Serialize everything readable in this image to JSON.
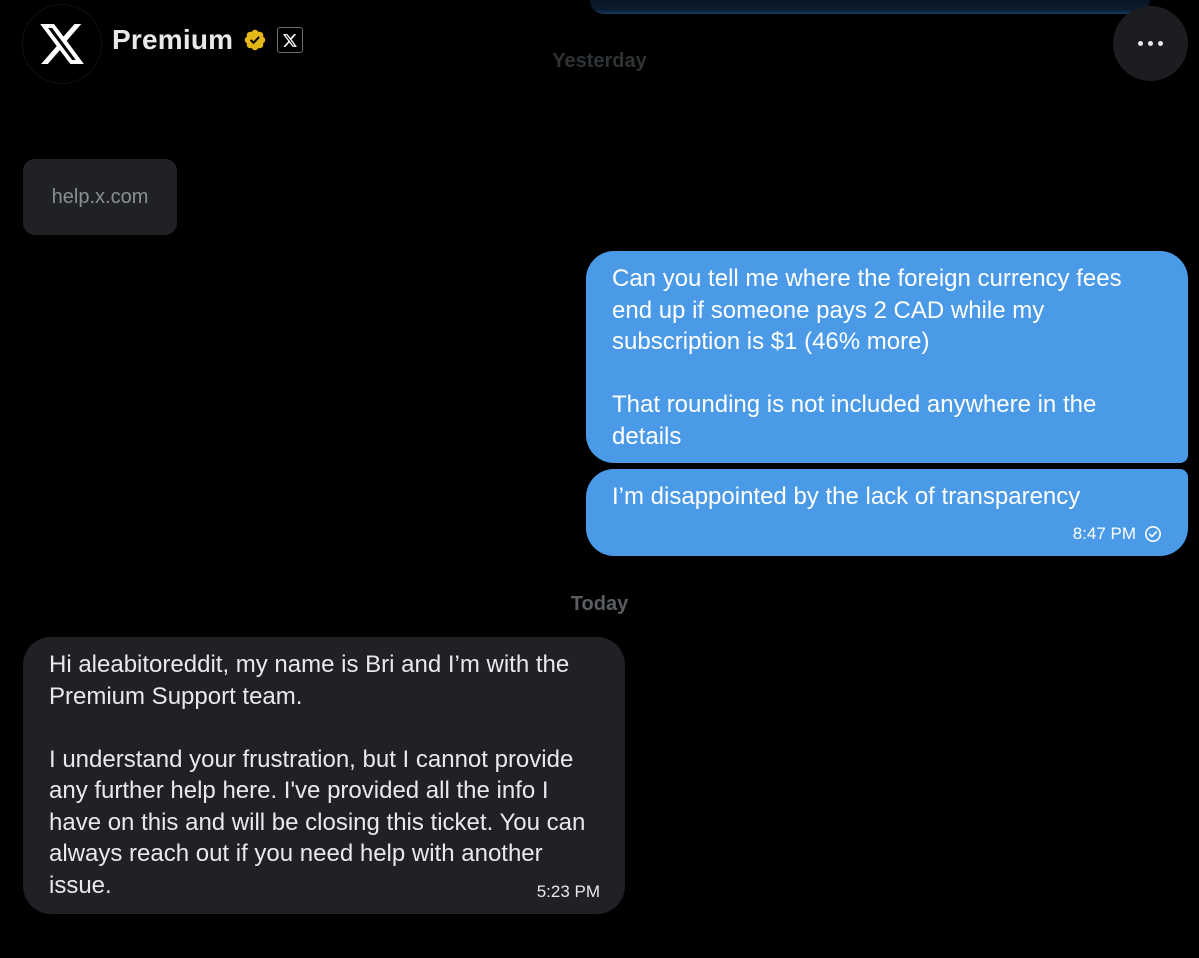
{
  "header": {
    "name": "Premium",
    "avatar_icon": "x-logo-icon",
    "verified_icon": "gold-verified-badge-icon",
    "verified_color": "#e2b719",
    "affiliate_icon": "x-affiliate-badge-icon",
    "more_icon": "more-horizontal-icon"
  },
  "days": {
    "yesterday": "Yesterday",
    "today": "Today"
  },
  "messages": {
    "link": "help.x.com",
    "out1": {
      "p1": "Can you tell me where the foreign currency fees end up if someone pays 2 CAD while my subscription is $1 (46% more)",
      "p2": "That rounding is not included anywhere in the details"
    },
    "out2": {
      "text": "I’m disappointed by the lack of transparency",
      "time": "8:47 PM",
      "status_icon": "seen-check-icon"
    },
    "in1": {
      "p1": "Hi aleabitoreddit, my name is Bri and I’m with the Premium Support team.",
      "p2": "I understand your frustration, but I cannot provide any further help here. I've provided all the info I have on this and will be closing this ticket. You can always reach out if you need help with another issue.",
      "time": "5:23 PM"
    }
  },
  "colors": {
    "background": "#000000",
    "outgoing_bubble": "#4a9ae8",
    "incoming_bubble": "#202124",
    "text": "#e7e9ea"
  }
}
